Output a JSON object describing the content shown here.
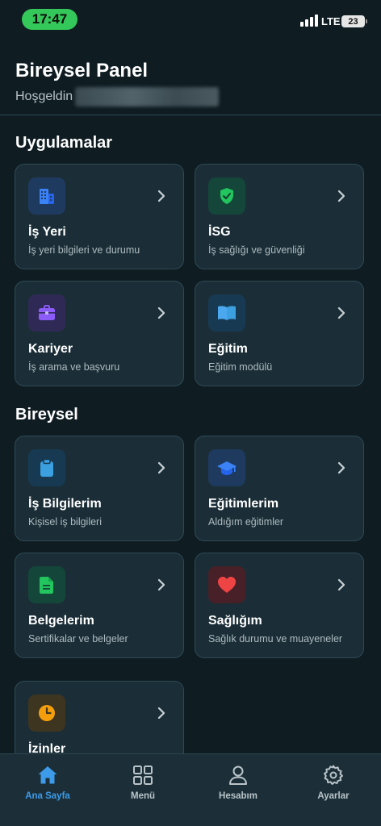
{
  "status_bar": {
    "time": "17:47",
    "network": "LTE",
    "battery": "23"
  },
  "header": {
    "title": "Bireysel Panel",
    "welcome": "Hoşgeldin"
  },
  "sections": [
    {
      "title": "Uygulamalar",
      "cards": [
        {
          "title": "İş Yeri",
          "subtitle": "İş yeri bilgileri ve durumu",
          "icon": "building-icon",
          "color": "#3b82f6"
        },
        {
          "title": "İSG",
          "subtitle": "İş sağlığı ve güvenliği",
          "icon": "shield-check-icon",
          "color": "#22c55e"
        },
        {
          "title": "Kariyer",
          "subtitle": "İş arama ve başvuru",
          "icon": "briefcase-icon",
          "color": "#8b5cf6"
        },
        {
          "title": "Eğitim",
          "subtitle": "Eğitim modülü",
          "icon": "book-icon",
          "color": "#3b9fe0"
        }
      ]
    },
    {
      "title": "Bireysel",
      "cards": [
        {
          "title": "İş Bilgilerim",
          "subtitle": "Kişisel iş bilgileri",
          "icon": "clipboard-icon",
          "color": "#3b9fe0"
        },
        {
          "title": "Eğitimlerim",
          "subtitle": "Aldığım eğitimler",
          "icon": "graduation-cap-icon",
          "color": "#3b82f6"
        },
        {
          "title": "Belgelerim",
          "subtitle": "Sertifikalar ve belgeler",
          "icon": "document-icon",
          "color": "#22c55e"
        },
        {
          "title": "Sağlığım",
          "subtitle": "Sağlık durumu ve muayeneler",
          "icon": "heart-icon",
          "color": "#ef4444"
        },
        {
          "title": "İzinler",
          "subtitle": "",
          "icon": "clock-icon",
          "color": "#f59e0b"
        }
      ]
    }
  ],
  "bottom_nav": [
    {
      "label": "Ana Sayfa",
      "icon": "home-icon",
      "active": true
    },
    {
      "label": "Menü",
      "icon": "grid-icon",
      "active": false
    },
    {
      "label": "Hesabım",
      "icon": "user-icon",
      "active": false
    },
    {
      "label": "Ayarlar",
      "icon": "gear-icon",
      "active": false
    }
  ],
  "colors": {
    "background": "#0f1c22",
    "card": "#1b2e37",
    "accent": "#3d9be9"
  }
}
